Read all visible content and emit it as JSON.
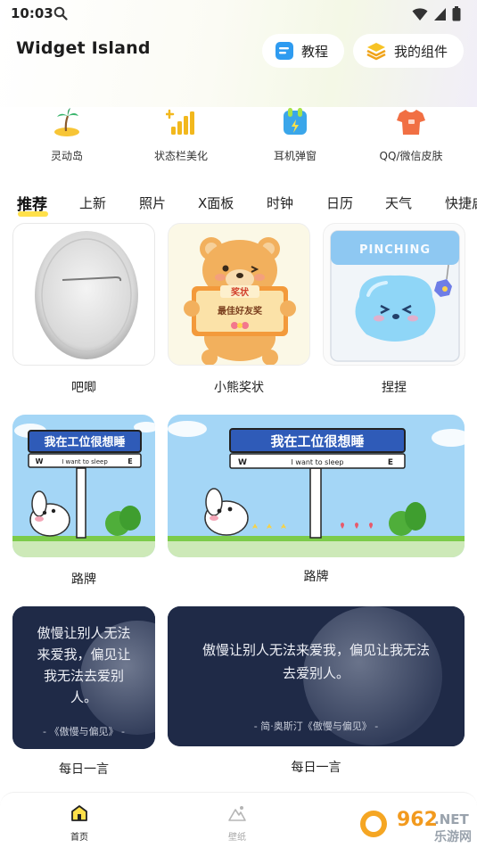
{
  "status_bar": {
    "time": "10:03"
  },
  "header": {
    "app_title": "Widget Island",
    "tutorial_label": "教程",
    "my_widgets_label": "我的组件"
  },
  "features": [
    {
      "label": "灵动岛",
      "icon": "palm-island-icon"
    },
    {
      "label": "状态栏美化",
      "icon": "signal-bars-icon"
    },
    {
      "label": "耳机弹窗",
      "icon": "earbuds-icon"
    },
    {
      "label": "QQ/微信皮肤",
      "icon": "tshirt-icon"
    }
  ],
  "tabs": [
    "推荐",
    "上新",
    "照片",
    "X面板",
    "时钟",
    "日历",
    "天气",
    "快捷启动"
  ],
  "active_tab": "推荐",
  "widgets": {
    "pin": {
      "label": "吧唧"
    },
    "bear": {
      "label": "小熊奖状",
      "certificate_title": "奖状",
      "certificate_text": "最佳好友奖"
    },
    "squish": {
      "label": "捏捏",
      "bag_text": "PINCHING"
    },
    "sign_small": {
      "label": "路牌",
      "sign_title": "我在工位很想睡",
      "sign_sub": "I want to sleep",
      "left_dir": "W",
      "right_dir": "E"
    },
    "sign_large": {
      "label": "路牌",
      "sign_title": "我在工位很想睡",
      "sign_sub": "I want to sleep",
      "left_dir": "W",
      "right_dir": "E"
    },
    "quote_small": {
      "label": "每日一言",
      "lines": [
        "傲慢让别人无法",
        "来爱我，偏见让",
        "我无法去爱别",
        "人。"
      ],
      "source": "- 《傲慢与偏见》 -"
    },
    "quote_large": {
      "label": "每日一言",
      "lines": [
        "傲慢让别人无法来爱我，偏见让我无法",
        "去爱别人。"
      ],
      "source": "- 简·奥斯汀《傲慢与偏见》 -"
    }
  },
  "bottom_nav": [
    {
      "label": "首页",
      "active": true
    },
    {
      "label": "壁纸",
      "active": false
    }
  ],
  "watermark": {
    "brand": "962",
    "suffix": ".NET",
    "sub": "乐游网"
  },
  "colors": {
    "accent_yellow": "#ffe04a",
    "sign_blue": "#2f5bb8",
    "sky_blue": "#9fd3f5",
    "grass_green": "#7ccb4a",
    "quote_bg": "#1f2a47"
  }
}
